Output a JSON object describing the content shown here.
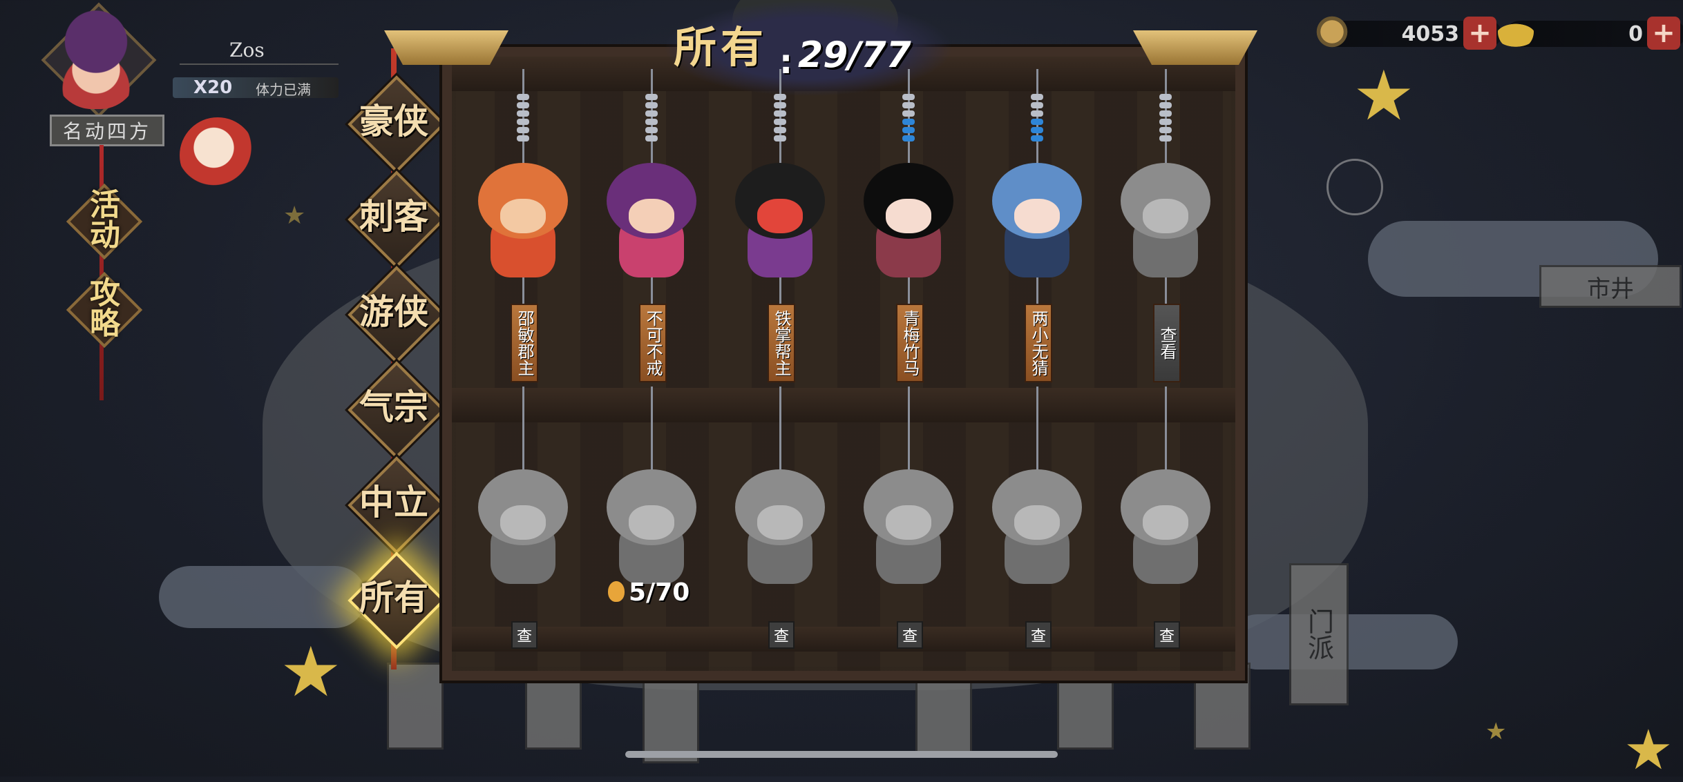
{
  "player": {
    "name": "Zos",
    "stamina_multiplier": "X20",
    "stamina_status": "体力已满",
    "title": "名动四方"
  },
  "side_menu": [
    {
      "label": "活动"
    },
    {
      "label": "攻略"
    }
  ],
  "currencies": [
    {
      "icon": "leaf-coin-icon",
      "value": "4053"
    },
    {
      "icon": "gold-ingot-icon",
      "value": "0"
    }
  ],
  "tabs": [
    {
      "label": "豪侠",
      "active": false
    },
    {
      "label": "刺客",
      "active": false
    },
    {
      "label": "游侠",
      "active": false
    },
    {
      "label": "气宗",
      "active": false
    },
    {
      "label": "中立",
      "active": false
    },
    {
      "label": "所有",
      "active": true
    }
  ],
  "collection": {
    "label": "所有",
    "value": "29/77"
  },
  "characters_top": [
    {
      "name": "邵敏郡主",
      "owned": true,
      "colors": [
        "#e0733a",
        "#d9502e",
        "#f3c9a3"
      ]
    },
    {
      "name": "不可不戒",
      "owned": true,
      "colors": [
        "#6a2f7a",
        "#c9416e",
        "#f4cfb7"
      ]
    },
    {
      "name": "铁掌帮主",
      "owned": true,
      "colors": [
        "#1d1d1d",
        "#7a3b8f",
        "#e2453a"
      ]
    },
    {
      "name": "青梅竹马",
      "owned": true,
      "colors": [
        "#0d0d0d",
        "#8b3a4a",
        "#f6dcd0"
      ]
    },
    {
      "name": "两小无猜",
      "owned": true,
      "colors": [
        "#5f8ec8",
        "#2c3f63",
        "#f6dcd0"
      ]
    },
    {
      "name": "查看",
      "owned": false,
      "colors": [
        "#8c8c8c",
        "#6f6f6f",
        "#b8b8b8"
      ]
    }
  ],
  "characters_bottom": [
    {
      "name": "查",
      "owned": false
    },
    {
      "name": "",
      "owned": false,
      "progress": "5/70"
    },
    {
      "name": "查",
      "owned": false
    },
    {
      "name": "查",
      "owned": false
    },
    {
      "name": "查",
      "owned": false
    },
    {
      "name": "查",
      "owned": false
    }
  ],
  "background_tags": [
    "市井",
    "门派"
  ]
}
